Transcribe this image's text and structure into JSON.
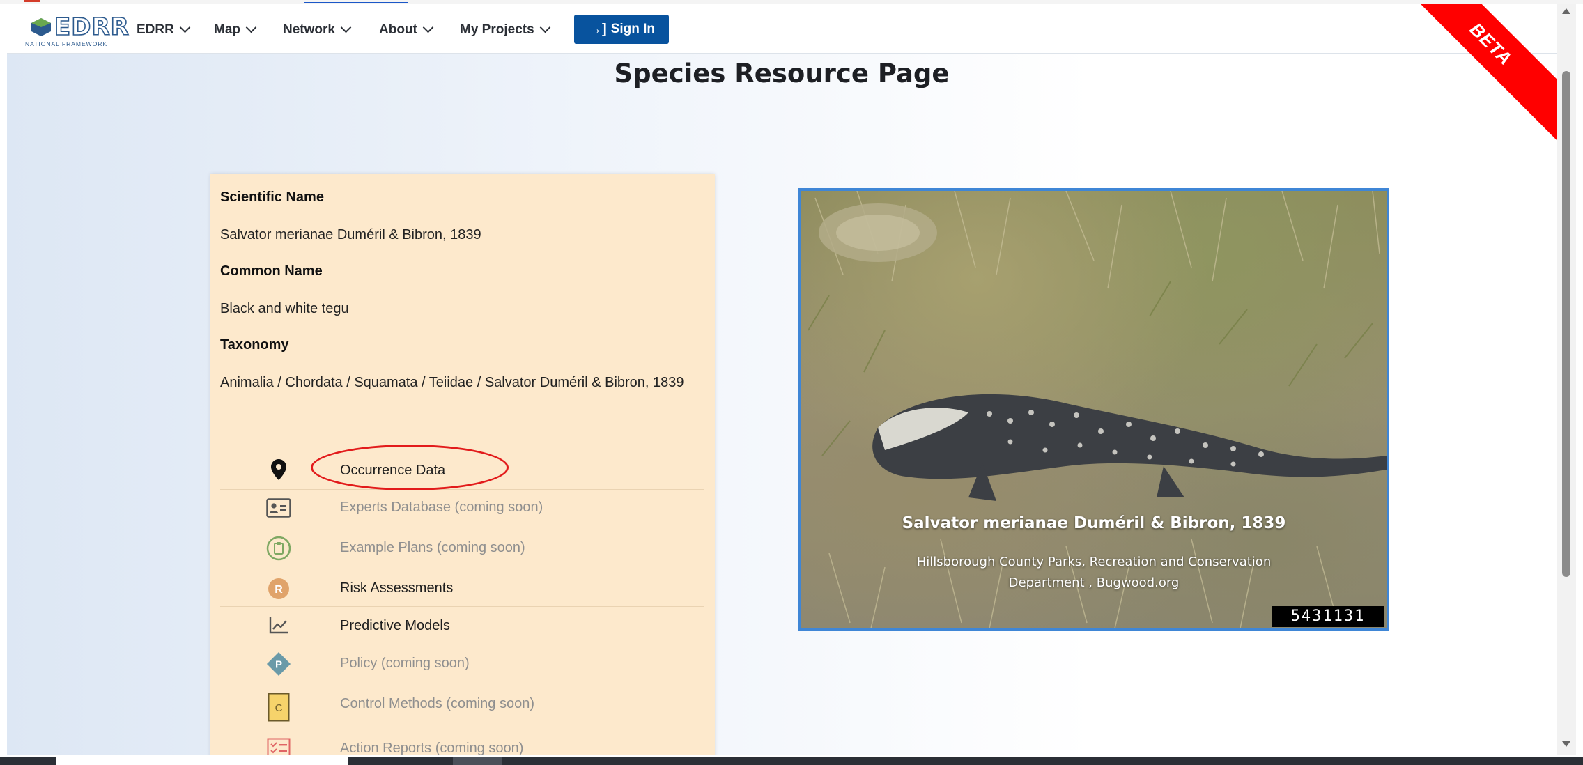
{
  "nav": {
    "logo_word": "EDRR",
    "logo_sub": "NATIONAL FRAMEWORK",
    "items": [
      {
        "label": "EDRR"
      },
      {
        "label": "Map"
      },
      {
        "label": "Network"
      },
      {
        "label": "About"
      },
      {
        "label": "My Projects"
      }
    ],
    "signin_label": "Sign In"
  },
  "beta_label": "BETA",
  "page_title": "Species Resource Page",
  "species": {
    "scientific_name_label": "Scientific Name",
    "scientific_name": "Salvator merianae Duméril & Bibron, 1839",
    "common_name_label": "Common Name",
    "common_name": "Black and white tegu",
    "taxonomy_label": "Taxonomy",
    "taxonomy": "Animalia / Chordata / Squamata / Teiidae / Salvator Duméril & Bibron, 1839"
  },
  "resources": [
    {
      "label": "Occurrence Data",
      "icon": "map-pin-icon",
      "available": true
    },
    {
      "label": "Experts Database (coming soon)",
      "icon": "id-card-icon",
      "available": false
    },
    {
      "label": "Example Plans (coming soon)",
      "icon": "clipboard-icon",
      "available": false
    },
    {
      "label": "Risk Assessments",
      "icon": "r-badge-icon",
      "icon_letter": "R",
      "available": true
    },
    {
      "label": "Predictive Models",
      "icon": "line-chart-icon",
      "available": true
    },
    {
      "label": "Policy (coming soon)",
      "icon": "p-diamond-icon",
      "icon_letter": "P",
      "available": false
    },
    {
      "label": "Control Methods (coming soon)",
      "icon": "c-square-icon",
      "icon_letter": "C",
      "available": false
    },
    {
      "label": "Action Reports (coming soon)",
      "icon": "checklist-icon",
      "available": false
    }
  ],
  "photo": {
    "caption": "Salvator merianae Duméril & Bibron, 1839",
    "credit": "Hillsborough County Parks, Recreation and Conservation Department , Bugwood.org",
    "image_id": "5431131"
  },
  "colors": {
    "nav_button": "#08539e",
    "beta_banner": "#ff0000",
    "card_background": "#fde9cc",
    "photo_border": "#3f86d6",
    "highlight": "#e21b1b"
  }
}
